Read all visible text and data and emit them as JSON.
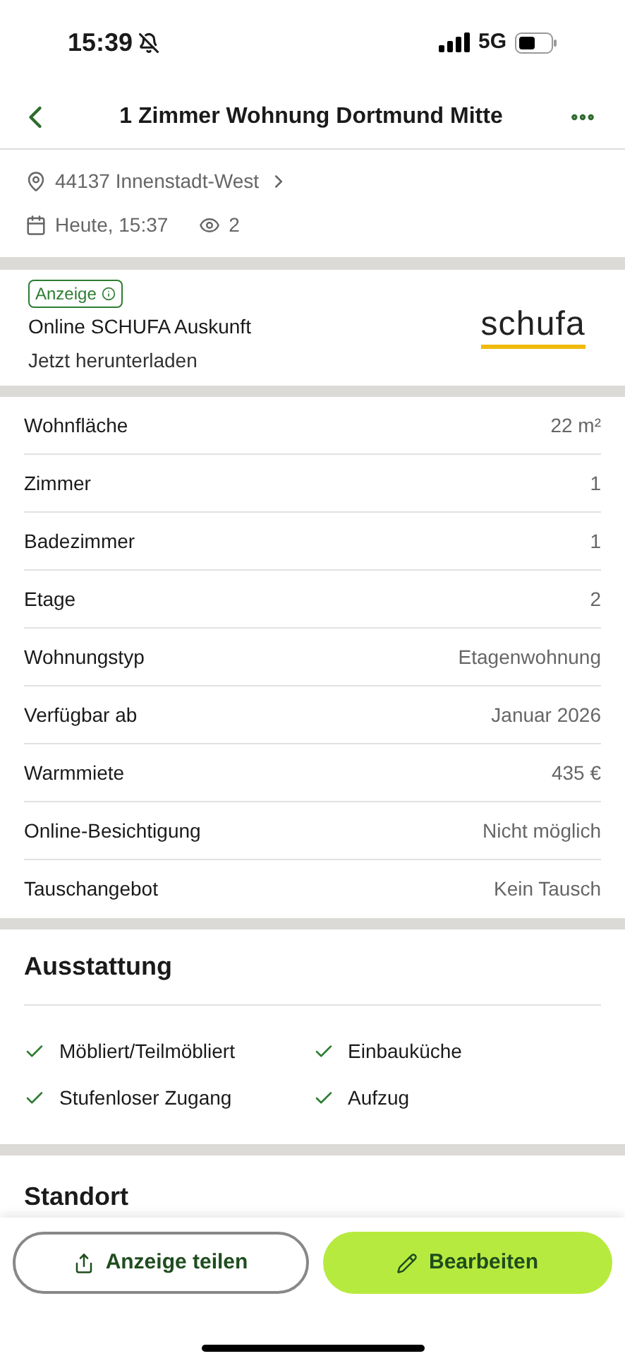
{
  "status_bar": {
    "time": "15:39",
    "network": "5G"
  },
  "header": {
    "title": "1 Zimmer Wohnung Dortmund Mitte"
  },
  "meta": {
    "location": "44137 Innenstadt-West",
    "date": "Heute, 15:37",
    "views": "2"
  },
  "ad": {
    "badge": "Anzeige",
    "title": "Online SCHUFA Auskunft",
    "subtitle": "Jetzt herunterladen",
    "logo": "schufa"
  },
  "details": [
    {
      "label": "Wohnfläche",
      "value": "22 m²"
    },
    {
      "label": "Zimmer",
      "value": "1"
    },
    {
      "label": "Badezimmer",
      "value": "1"
    },
    {
      "label": "Etage",
      "value": "2"
    },
    {
      "label": "Wohnungstyp",
      "value": "Etagenwohnung"
    },
    {
      "label": "Verfügbar ab",
      "value": "Januar 2026"
    },
    {
      "label": "Warmmiete",
      "value": "435 €"
    },
    {
      "label": "Online-Besichtigung",
      "value": "Nicht möglich"
    },
    {
      "label": "Tauschangebot",
      "value": "Kein Tausch"
    }
  ],
  "features": {
    "title": "Ausstattung",
    "items": [
      {
        "label": "Möbliert/Teilmöbliert",
        "checked": true
      },
      {
        "label": "Einbauküche",
        "checked": true
      },
      {
        "label": "Stufenloser Zugang",
        "checked": true
      },
      {
        "label": "Aufzug",
        "checked": true
      }
    ]
  },
  "location_section": {
    "title": "Standort"
  },
  "actions": [
    {
      "kind": "share",
      "label": "Anzeige teilen"
    },
    {
      "kind": "edit",
      "label": "Bearbeiten"
    }
  ]
}
